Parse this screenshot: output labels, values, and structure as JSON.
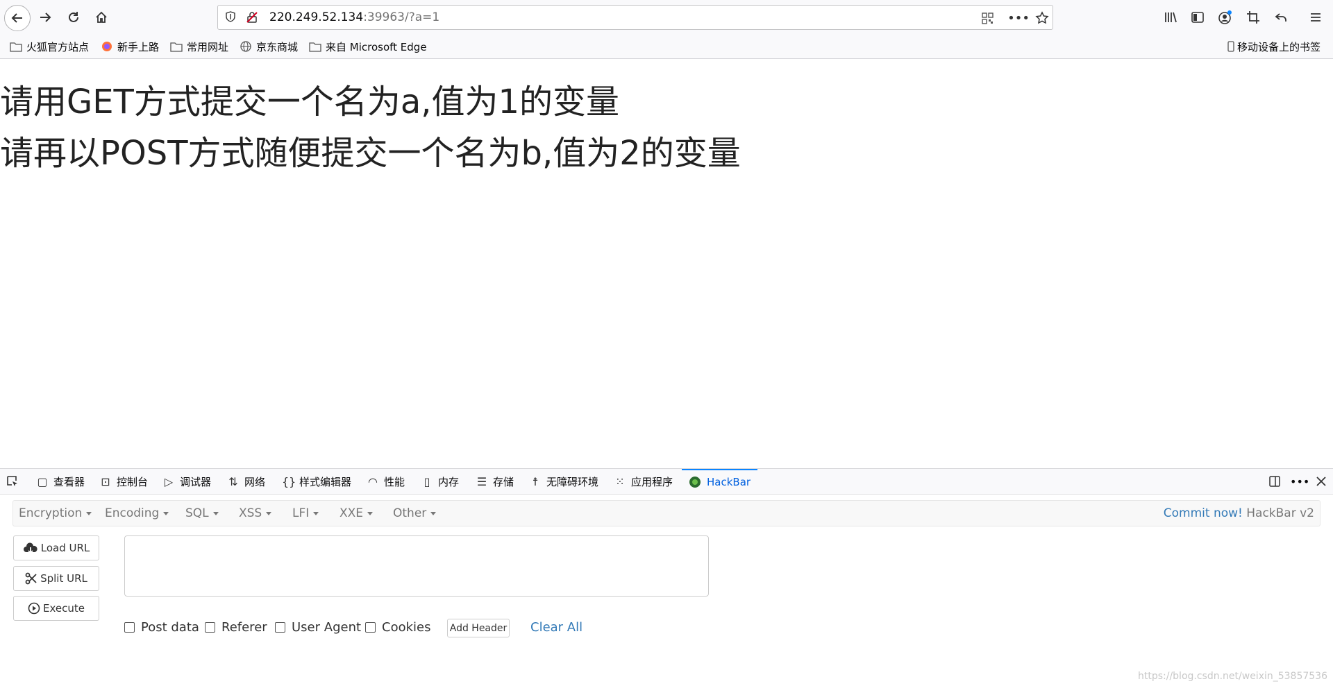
{
  "browser": {
    "url_host": "220.249.52.134",
    "url_rest": ":39963/?a=1"
  },
  "bookmarks": [
    {
      "label": "火狐官方站点",
      "icon": "folder-icon"
    },
    {
      "label": "新手上路",
      "icon": "firefox-icon"
    },
    {
      "label": "常用网址",
      "icon": "folder-icon"
    },
    {
      "label": "京东商城",
      "icon": "globe-icon"
    },
    {
      "label": "来自 Microsoft Edge",
      "icon": "folder-icon"
    }
  ],
  "mobile_bookmarks": "移动设备上的书签",
  "page": {
    "line1": "请用GET方式提交一个名为a,值为1的变量",
    "line2": "请再以POST方式随便提交一个名为b,值为2的变量"
  },
  "devtools": {
    "tabs": [
      {
        "label": "查看器",
        "icon": "inspector-icon"
      },
      {
        "label": "控制台",
        "icon": "console-icon"
      },
      {
        "label": "调试器",
        "icon": "debugger-icon"
      },
      {
        "label": "网络",
        "icon": "network-icon"
      },
      {
        "label": "样式编辑器",
        "icon": "style-editor-icon"
      },
      {
        "label": "性能",
        "icon": "performance-icon"
      },
      {
        "label": "内存",
        "icon": "memory-icon"
      },
      {
        "label": "存储",
        "icon": "storage-icon"
      },
      {
        "label": "无障碍环境",
        "icon": "accessibility-icon"
      },
      {
        "label": "应用程序",
        "icon": "application-icon"
      },
      {
        "label": "HackBar",
        "icon": "hackbar-icon"
      }
    ],
    "active_tab": "HackBar"
  },
  "hackbar": {
    "menu": [
      "Encryption",
      "Encoding",
      "SQL",
      "XSS",
      "LFI",
      "XXE",
      "Other"
    ],
    "commit_link": "Commit now!",
    "version": "HackBar v2",
    "load_url": "Load URL",
    "split_url": "Split URL",
    "execute": "Execute",
    "url_value": "",
    "checks": [
      "Post data",
      "Referer",
      "User Agent",
      "Cookies"
    ],
    "add_header": "Add Header",
    "clear_all": "Clear All"
  },
  "watermark": "https://blog.csdn.net/weixin_53857536",
  "colors": {
    "accent": "#0a84ff",
    "link": "#337ab7"
  }
}
